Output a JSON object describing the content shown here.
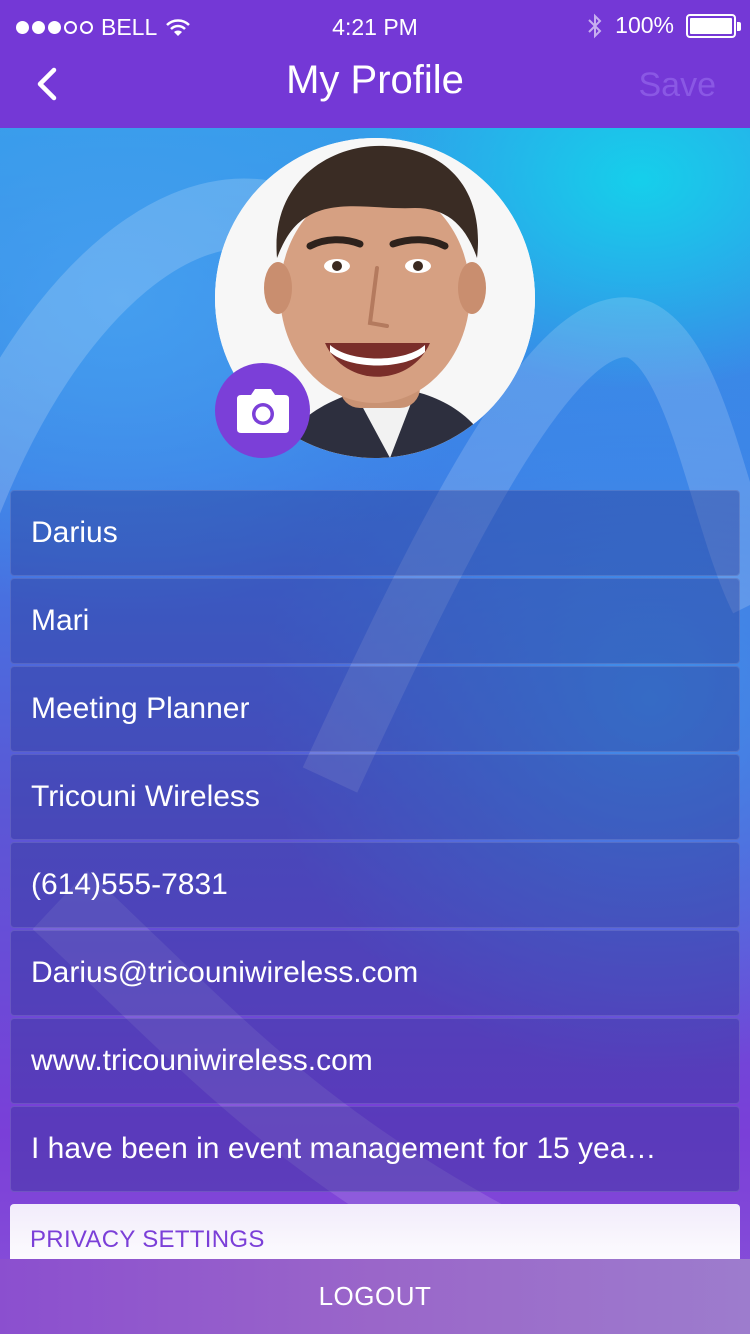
{
  "status_bar": {
    "carrier": "BELL",
    "time": "4:21 PM",
    "battery_text": "100%",
    "battery_level": 1.0,
    "signal_bars_filled": 3,
    "signal_bars_total": 5
  },
  "nav": {
    "title": "My Profile",
    "save_label": "Save",
    "back_icon": "chevron-left-icon"
  },
  "avatar": {
    "camera_icon": "camera-icon"
  },
  "fields": [
    {
      "name": "first-name-field",
      "value": "Darius"
    },
    {
      "name": "last-name-field",
      "value": "Mari"
    },
    {
      "name": "job-title-field",
      "value": "Meeting Planner"
    },
    {
      "name": "company-field",
      "value": "Tricouni Wireless"
    },
    {
      "name": "phone-field",
      "value": "(614)555-7831"
    },
    {
      "name": "email-field",
      "value": "Darius@tricouniwireless.com"
    },
    {
      "name": "website-field",
      "value": "www.tricouniwireless.com"
    },
    {
      "name": "bio-field",
      "value": "I have been in event management for 15 yea…"
    }
  ],
  "privacy": {
    "label": "PRIVACY SETTINGS"
  },
  "logout": {
    "label": "LOGOUT"
  },
  "colors": {
    "accent": "#7438d6",
    "save_disabled": "#8a58e4",
    "camera_button": "#7b3fd8"
  }
}
